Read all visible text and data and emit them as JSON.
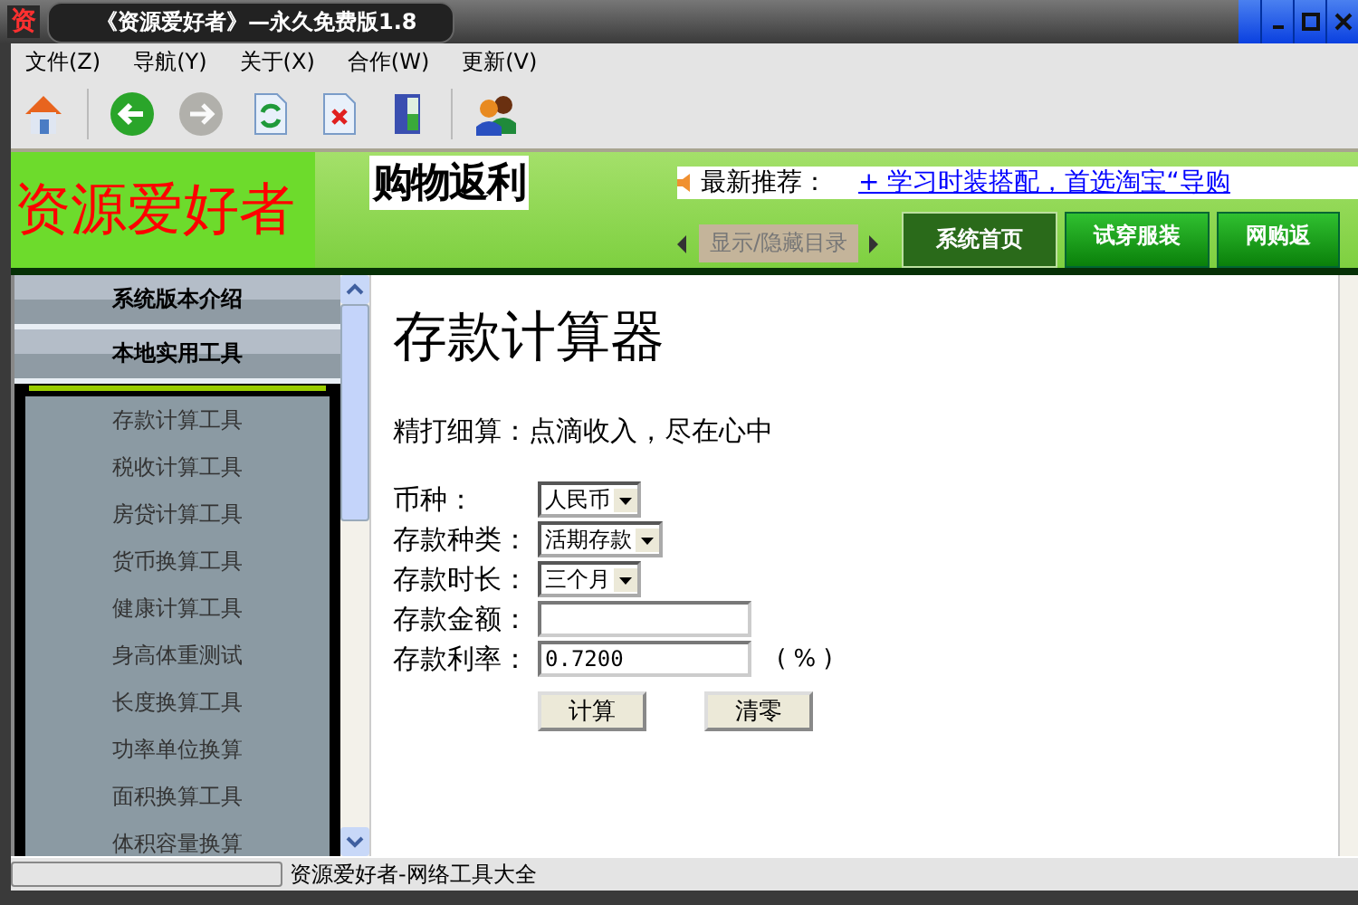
{
  "window": {
    "app_icon": "资",
    "title": "《资源爱好者》—永久免费版1.8"
  },
  "menu": [
    "文件(Z)",
    "导航(Y)",
    "关于(X)",
    "合作(W)",
    "更新(V)"
  ],
  "toolbar": [
    {
      "kind": "home",
      "disabled": false
    },
    {
      "kind": "back",
      "disabled": false
    },
    {
      "kind": "forward",
      "disabled": true
    },
    {
      "kind": "refresh",
      "disabled": false
    },
    {
      "kind": "stop",
      "disabled": false
    },
    {
      "kind": "exit",
      "disabled": false
    },
    {
      "kind": "users",
      "disabled": false
    }
  ],
  "banner": {
    "logo": "资源爱好者",
    "ad": "购物返利",
    "ticker_label": "最新推荐：",
    "ticker_link": "+ 学习时装搭配，首选淘宝“导购",
    "toggle": "显示/隐藏目录",
    "tabs": [
      {
        "label": "系统首页",
        "selected": true
      },
      {
        "label": "试穿服装",
        "selected": false
      },
      {
        "label": "网购返",
        "selected": false
      }
    ]
  },
  "sidebar": {
    "sections": [
      "系统版本介绍",
      "本地实用工具"
    ],
    "items": [
      "存款计算工具",
      "税收计算工具",
      "房贷计算工具",
      "货币换算工具",
      "健康计算工具",
      "身高体重测试",
      "长度换算工具",
      "功率单位换算",
      "面积换算工具",
      "体积容量换算"
    ]
  },
  "content": {
    "title": "存款计算器",
    "subtitle": "精打细算：点滴收入，尽在心中",
    "fields": [
      {
        "label": "币种：",
        "kind": "select",
        "value": "人民币"
      },
      {
        "label": "存款种类：",
        "kind": "select",
        "value": "活期存款"
      },
      {
        "label": "存款时长：",
        "kind": "select",
        "value": "三个月"
      },
      {
        "label": "存款金额：",
        "kind": "input"
      },
      {
        "label": "存款利率：",
        "kind": "input",
        "value": "0.7200",
        "unit": "( % )"
      }
    ],
    "buttons": [
      "计算",
      "清零"
    ]
  },
  "status_bar": {
    "text": "资源爱好者-网络工具大全"
  }
}
